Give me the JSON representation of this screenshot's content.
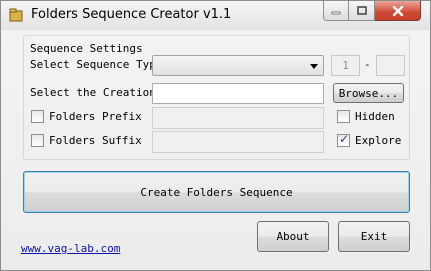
{
  "window": {
    "title": "Folders Sequence Creator v1.1"
  },
  "group": {
    "title": "Sequence Settings",
    "sequence_type_label": "Select Sequence Type:",
    "sequence_type_value": "",
    "range_start": "1",
    "range_separator": "-",
    "range_end": "",
    "creation_label": "Select the Creation F",
    "creation_path": "",
    "browse_label": "Browse...",
    "prefix_label": "Folders Prefix",
    "prefix_checked": false,
    "prefix_value": "",
    "suffix_label": "Folders Suffix",
    "suffix_checked": false,
    "suffix_value": "",
    "hidden_label": "Hidden",
    "hidden_checked": false,
    "explore_label": "Explore",
    "explore_checked": true,
    "check_glyph": "✓"
  },
  "actions": {
    "create_label": "Create Folders Sequence",
    "about_label": "About",
    "exit_label": "Exit",
    "website": "www.vag-lab.com"
  },
  "colors": {
    "link": "#0a14a8",
    "close_button": "#d04a35",
    "primary_border": "#3c7fb1"
  },
  "icons": {
    "app": "folder-icon",
    "minimize": "minimize-icon",
    "maximize": "maximize-icon",
    "close": "close-icon",
    "dropdown": "chevron-down-icon"
  }
}
